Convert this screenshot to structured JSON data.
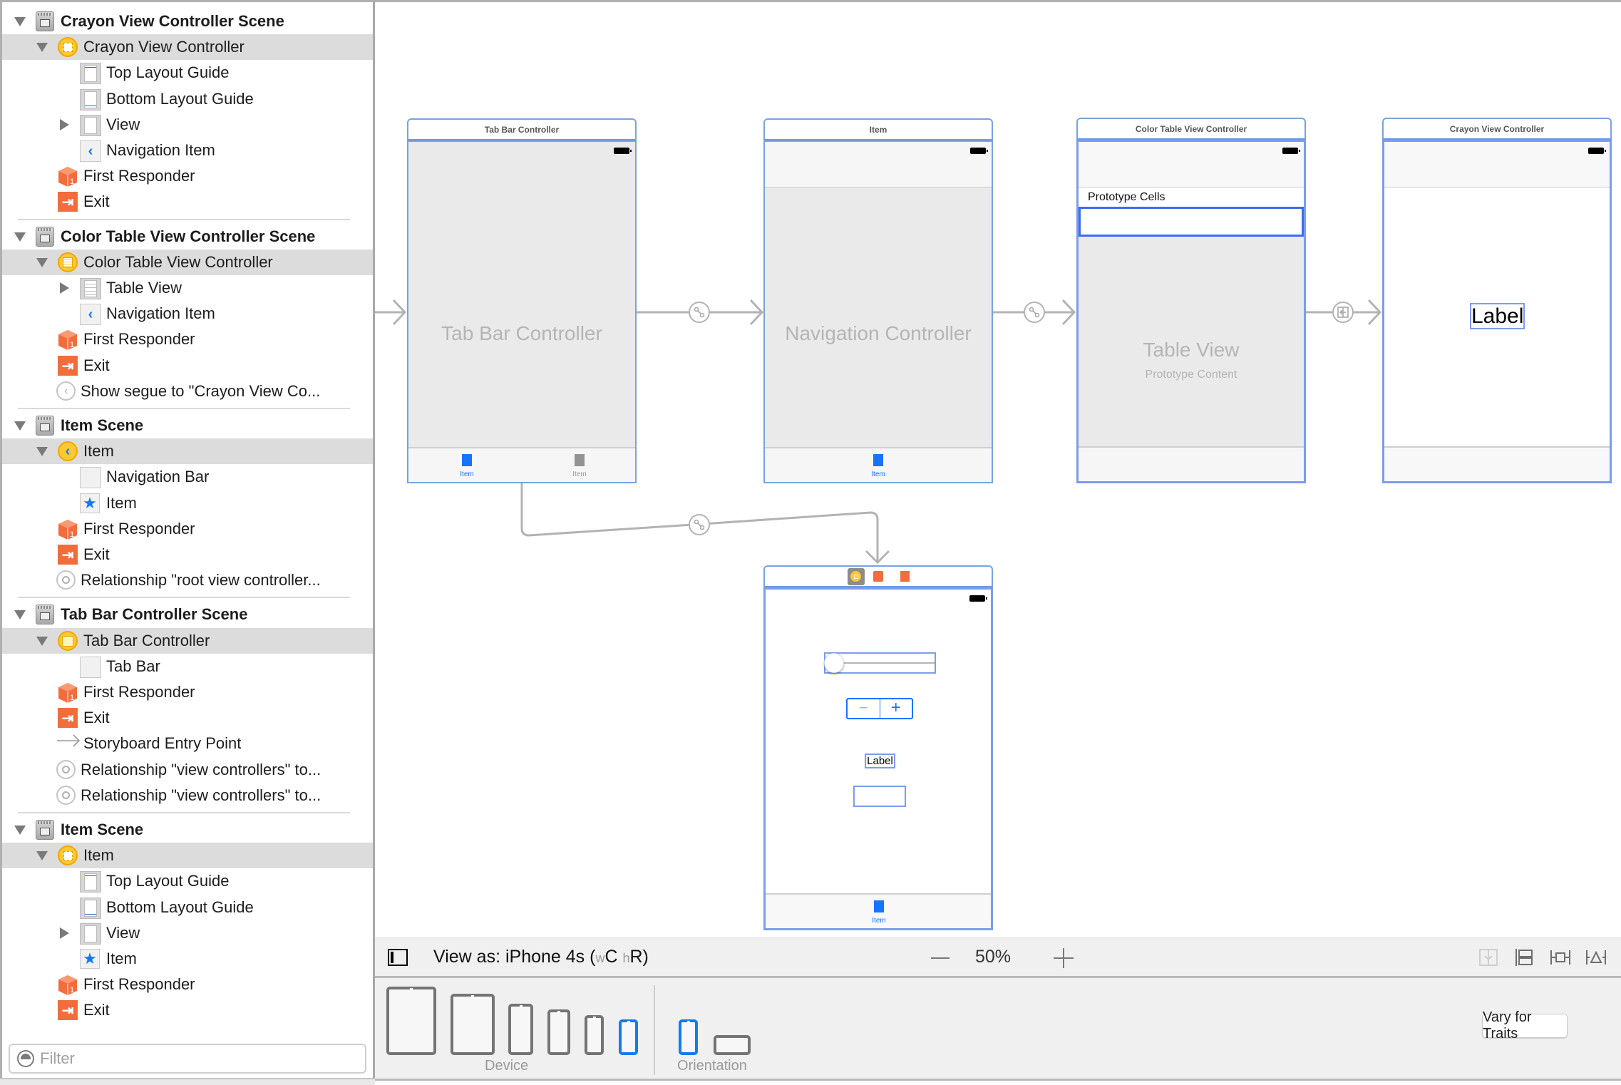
{
  "outline": {
    "scenes": [
      {
        "title": "Crayon View Controller Scene",
        "controller": "Crayon View Controller",
        "children": [
          "Top Layout Guide",
          "Bottom Layout Guide",
          "View",
          "Navigation Item"
        ],
        "responder": "First Responder",
        "exit": "Exit",
        "extras": []
      },
      {
        "title": "Color Table View Controller Scene",
        "controller": "Color Table View Controller",
        "children": [
          "Table View",
          "Navigation Item"
        ],
        "responder": "First Responder",
        "exit": "Exit",
        "extras": [
          "Show segue to \"Crayon View Co..."
        ]
      },
      {
        "title": "Item Scene",
        "controller": "Item",
        "children": [
          "Navigation Bar",
          "Item"
        ],
        "responder": "First Responder",
        "exit": "Exit",
        "extras": [
          "Relationship \"root view controller..."
        ]
      },
      {
        "title": "Tab Bar Controller Scene",
        "controller": "Tab Bar Controller",
        "children": [
          "Tab Bar"
        ],
        "responder": "First Responder",
        "exit": "Exit",
        "extras": [
          "Storyboard Entry Point",
          "Relationship \"view controllers\" to...",
          "Relationship \"view controllers\" to..."
        ]
      },
      {
        "title": "Item Scene",
        "controller": "Item",
        "children": [
          "Top Layout Guide",
          "Bottom Layout Guide",
          "View",
          "Item"
        ],
        "responder": "First Responder",
        "exit": "Exit",
        "extras": []
      }
    ],
    "filter": {
      "placeholder": "Filter",
      "value": ""
    }
  },
  "canvas": {
    "tab_bar_controller": {
      "title": "Tab Bar Controller",
      "placeholder": "Tab Bar Controller",
      "tabs": [
        "Item",
        "Item"
      ]
    },
    "navigation_controller": {
      "title": "Item",
      "placeholder": "Navigation Controller",
      "tabs": [
        "Item"
      ]
    },
    "color_table_vc": {
      "title": "Color Table View Controller",
      "section_header": "Prototype Cells",
      "placeholder": "Table View",
      "placeholder_sub": "Prototype Content"
    },
    "crayon_vc": {
      "title": "Crayon View Controller",
      "label": "Label"
    },
    "item_vc": {
      "label": "Label",
      "stepper_minus": "−",
      "stepper_plus": "+",
      "slider_value": 0,
      "tabs": [
        "Item"
      ]
    }
  },
  "viewas": {
    "prefix": "View as: iPhone 4s (",
    "w_trait": "w",
    "w_value": "C",
    "h_trait": "h",
    "h_value": "R",
    "suffix": ")",
    "zoom": "50%"
  },
  "devices": {
    "device_label": "Device",
    "orientation_label": "Orientation",
    "vary_button": "Vary for Traits",
    "selected_device": "iPhone 4s",
    "selected_orientation": "portrait"
  },
  "colors": {
    "accent": "#1674ff",
    "selection_border": "#7b9cef",
    "exit_orange": "#f26d3c",
    "vc_yellow": "#fdc832"
  }
}
